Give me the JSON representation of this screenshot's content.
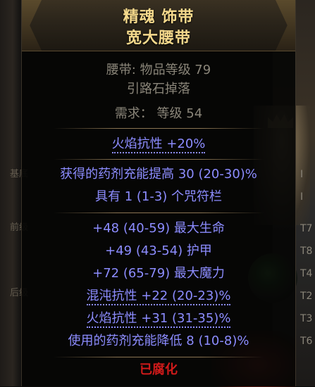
{
  "item": {
    "name_line1": "精魂 饰带",
    "name_line2": "宽大腰带",
    "base_info": "腰带: 物品等级 79",
    "drop_info": "引路石掉落",
    "requirement": "需求： 等级 54",
    "implicit": "火焰抗性 +20%",
    "enchant_mods": [
      "获得的药剂充能提高 30 (20-30)%",
      "具有 1 (1-3) 个咒符栏"
    ],
    "prefix_mods": [
      "+48 (40-59) 最大生命",
      "+49 (43-54) 护甲",
      "+72 (65-79) 最大魔力"
    ],
    "suffix_mods": [
      "混沌抗性 +22 (20-23)%",
      "火焰抗性 +31 (31-35)%",
      "使用的药剂充能降低 8 (10-8)%"
    ],
    "corrupted": "已腐化"
  },
  "side_labels": {
    "base": "基底",
    "prefix": "前级",
    "suffix": "后级"
  },
  "tiers": [
    "I",
    "I",
    "T7",
    "T8",
    "T4",
    "T2",
    "T3",
    "T6"
  ],
  "colors": {
    "title": "#f5d98c",
    "magic_blue": "#8c8cff",
    "corrupted_red": "#d01a1a",
    "grey_text": "#8a8579"
  }
}
